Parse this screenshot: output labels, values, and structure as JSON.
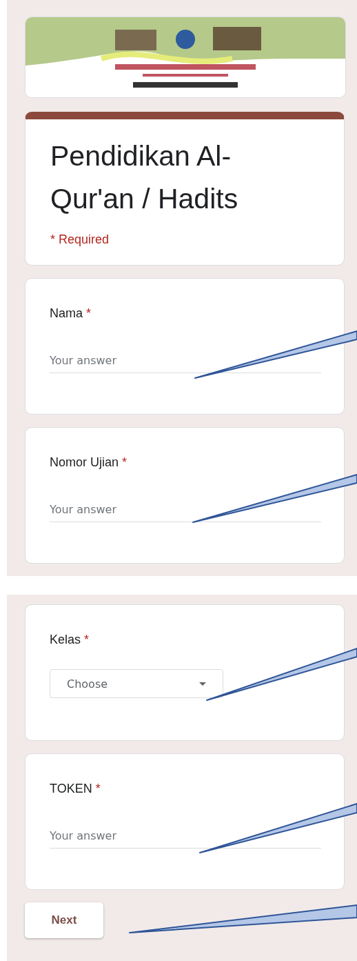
{
  "title_card": {
    "title": "Pendidikan Al-Qur'an / Hadits",
    "required_note": "* Required"
  },
  "screens": [
    {
      "questions": [
        {
          "kind": "text",
          "label": "Nama",
          "required_mark": "*",
          "placeholder": "Your answer"
        },
        {
          "kind": "text",
          "label": "Nomor Ujian",
          "required_mark": "*",
          "placeholder": "Your answer"
        }
      ]
    },
    {
      "questions": [
        {
          "kind": "dropdown",
          "label": "Kelas",
          "required_mark": "*",
          "placeholder": "Choose"
        },
        {
          "kind": "text",
          "label": "TOKEN",
          "required_mark": "*",
          "placeholder": "Your answer"
        }
      ],
      "next_button": "Next"
    }
  ]
}
